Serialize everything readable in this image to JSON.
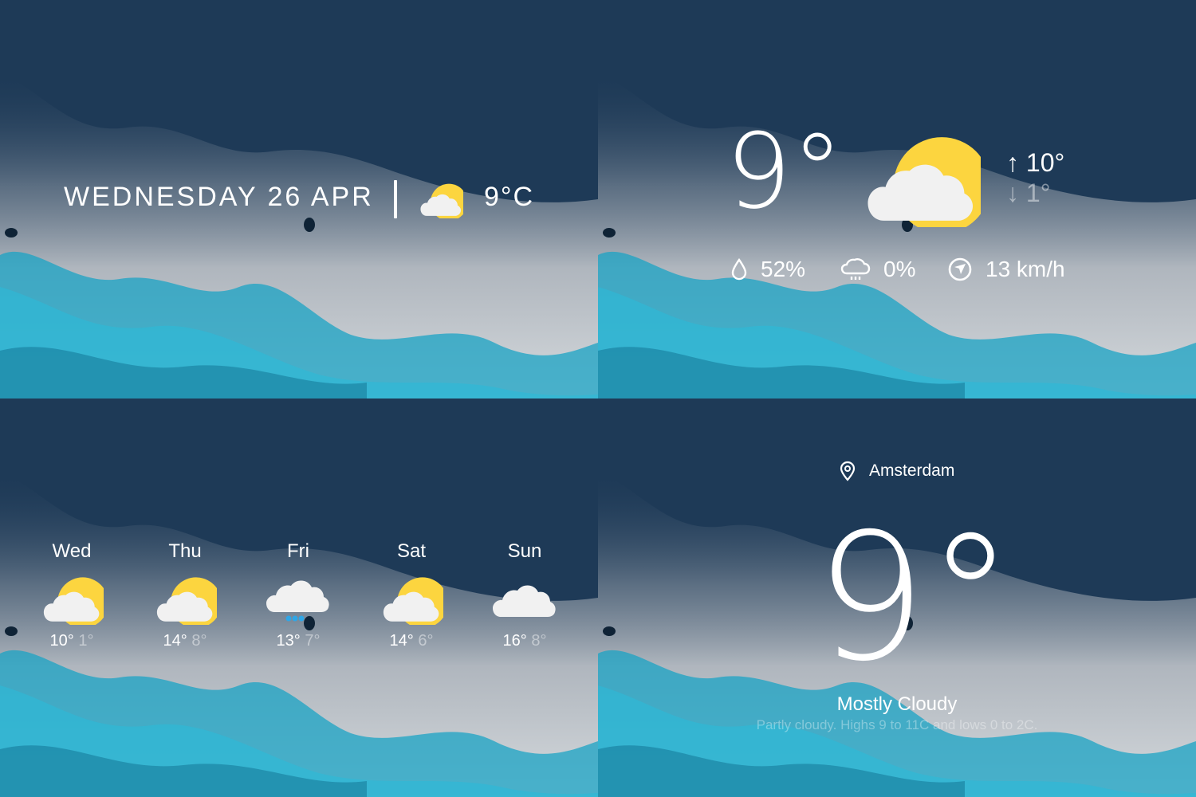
{
  "header": {
    "date": "WEDNESDAY 26 APR",
    "temperature": "9°C",
    "weather_icon": "partly-cloudy-icon"
  },
  "current": {
    "temperature": "9°",
    "weather_icon": "partly-cloudy-icon",
    "high": "10°",
    "low": "1°",
    "humidity": "52%",
    "precipitation": "0%",
    "wind": "13 km/h"
  },
  "forecast": [
    {
      "day": "Wed",
      "high": "10°",
      "low": "1°",
      "icon": "partly-cloudy-icon"
    },
    {
      "day": "Thu",
      "high": "14°",
      "low": "8°",
      "icon": "partly-cloudy-icon"
    },
    {
      "day": "Fri",
      "high": "13°",
      "low": "7°",
      "icon": "rain-cloud-icon"
    },
    {
      "day": "Sat",
      "high": "14°",
      "low": "6°",
      "icon": "partly-cloudy-icon"
    },
    {
      "day": "Sun",
      "high": "16°",
      "low": "8°",
      "icon": "cloud-icon"
    }
  ],
  "location": {
    "city": "Amsterdam",
    "temperature": "9°",
    "condition": "Mostly Cloudy",
    "description": "Partly cloudy. Highs 9 to 11C and lows 0 to 2C."
  },
  "colors": {
    "background": "#1e3a57",
    "sun": "#fcd53f",
    "cloud": "#f1f1f1",
    "rain": "#2fa6e6",
    "ice_blue": "#1aa3c4"
  }
}
